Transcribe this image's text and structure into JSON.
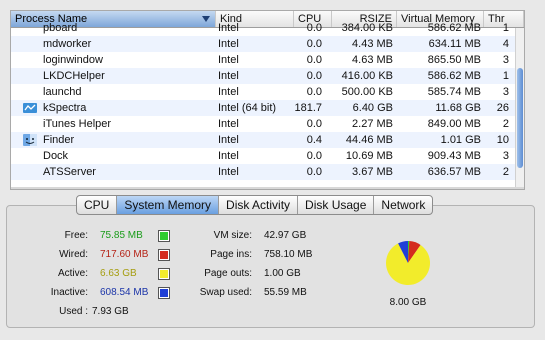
{
  "table": {
    "columns": {
      "name": "Process Name",
      "kind": "Kind",
      "cpu": "CPU",
      "rsize": "RSIZE",
      "vm": "Virtual Memory",
      "thr": "Thr"
    },
    "rows": [
      {
        "name": "pboard",
        "kind": "Intel",
        "cpu": "0.0",
        "rsize": "384.00 KB",
        "vm": "586.62 MB",
        "thr": "1",
        "icon": ""
      },
      {
        "name": "mdworker",
        "kind": "Intel",
        "cpu": "0.0",
        "rsize": "4.43 MB",
        "vm": "634.11 MB",
        "thr": "4",
        "icon": ""
      },
      {
        "name": "loginwindow",
        "kind": "Intel",
        "cpu": "0.0",
        "rsize": "4.63 MB",
        "vm": "865.50 MB",
        "thr": "3",
        "icon": ""
      },
      {
        "name": "LKDCHelper",
        "kind": "Intel",
        "cpu": "0.0",
        "rsize": "416.00 KB",
        "vm": "586.62 MB",
        "thr": "1",
        "icon": ""
      },
      {
        "name": "launchd",
        "kind": "Intel",
        "cpu": "0.0",
        "rsize": "500.00 KB",
        "vm": "585.74 MB",
        "thr": "3",
        "icon": ""
      },
      {
        "name": "kSpectra",
        "kind": "Intel (64 bit)",
        "cpu": "181.7",
        "rsize": "6.40 GB",
        "vm": "11.68 GB",
        "thr": "26",
        "icon": "kspectra-app-icon"
      },
      {
        "name": "iTunes Helper",
        "kind": "Intel",
        "cpu": "0.0",
        "rsize": "2.27 MB",
        "vm": "849.00 MB",
        "thr": "2",
        "icon": ""
      },
      {
        "name": "Finder",
        "kind": "Intel",
        "cpu": "0.4",
        "rsize": "44.46 MB",
        "vm": "1.01 GB",
        "thr": "10",
        "icon": "finder-app-icon"
      },
      {
        "name": "Dock",
        "kind": "Intel",
        "cpu": "0.0",
        "rsize": "10.69 MB",
        "vm": "909.43 MB",
        "thr": "3",
        "icon": ""
      },
      {
        "name": "ATSServer",
        "kind": "Intel",
        "cpu": "0.0",
        "rsize": "3.67 MB",
        "vm": "636.57 MB",
        "thr": "2",
        "icon": ""
      }
    ]
  },
  "tabs": [
    "CPU",
    "System Memory",
    "Disk Activity",
    "Disk Usage",
    "Network"
  ],
  "active_tab": "System Memory",
  "memory": {
    "free_label": "Free:",
    "free_value": "75.85 MB",
    "free_color": "#2ecc2e",
    "wired_label": "Wired:",
    "wired_value": "717.60 MB",
    "wired_color": "#d42b1e",
    "active_label": "Active:",
    "active_value": "6.63 GB",
    "active_color": "#f2ec2b",
    "inactive_label": "Inactive:",
    "inactive_value": "608.54 MB",
    "inactive_color": "#1f3fd6",
    "used_label": "Used :",
    "used_value": "7.93 GB"
  },
  "vm": {
    "vmsize_label": "VM size:",
    "vmsize_value": "42.97 GB",
    "pageins_label": "Page ins:",
    "pageins_value": "758.10 MB",
    "pageouts_label": "Page outs:",
    "pageouts_value": "1.00 GB",
    "swap_label": "Swap used:",
    "swap_value": "55.59 MB"
  },
  "pie": {
    "total_label": "8.00 GB",
    "slices_mb": [
      75.85,
      717.6,
      6789.12,
      608.54
    ],
    "colors": [
      "#2ecc2e",
      "#d42b1e",
      "#f2ec2b",
      "#1f3fd6"
    ]
  }
}
